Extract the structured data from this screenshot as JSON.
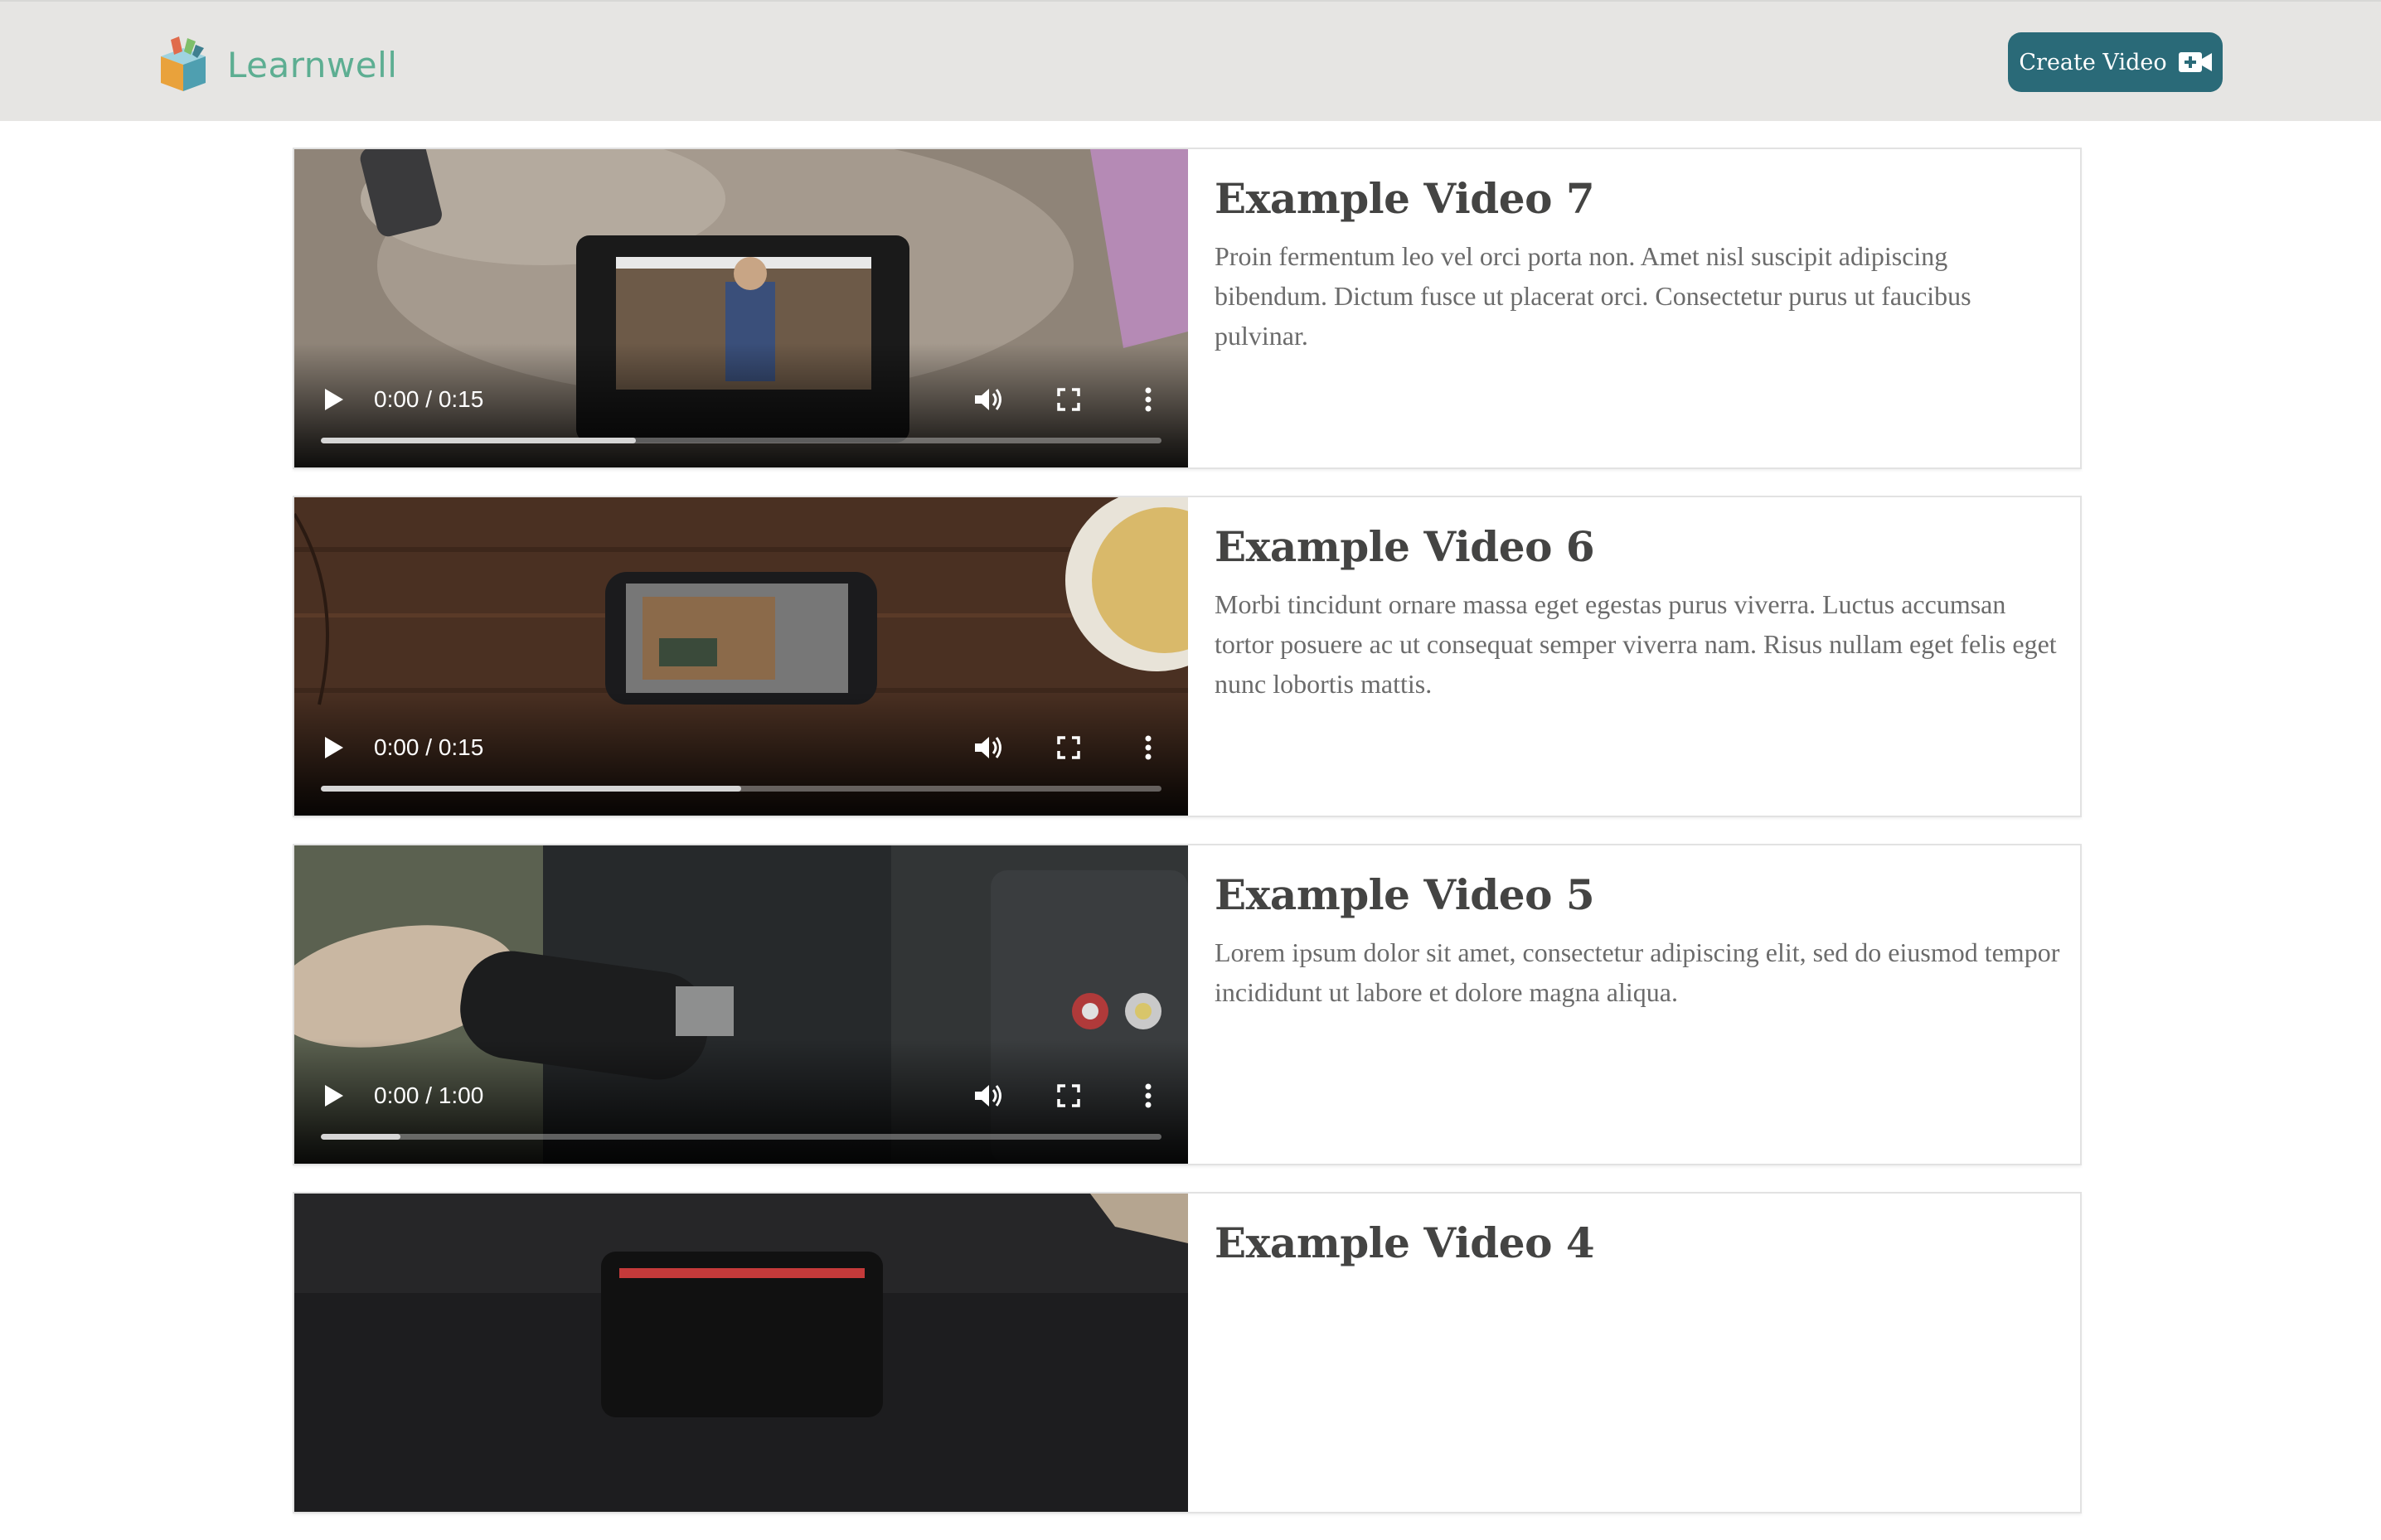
{
  "header": {
    "brand": "Learnwell",
    "create_button_label": "Create Video"
  },
  "colors": {
    "header_bg": "#e6e5e3",
    "brand_green": "#5dae92",
    "button_bg": "#2a6a78",
    "title_text": "#444443",
    "body_text": "#6b6b6b"
  },
  "videos": [
    {
      "title": "Example Video 7",
      "description": "Proin fermentum leo vel orci porta non. Amet nisl suscipit adipiscing bibendum. Dictum fusce ut placerat orci. Consectetur purus ut faucibus pulvinar.",
      "time": "0:00 / 0:15",
      "progress": 0.375
    },
    {
      "title": "Example Video 6",
      "description": "Morbi tincidunt ornare massa eget egestas purus viverra. Luctus accumsan tortor posuere ac ut consequat semper viverra nam. Risus nullam eget felis eget nunc lobortis mattis.",
      "time": "0:00 / 0:15",
      "progress": 0.5
    },
    {
      "title": "Example Video 5",
      "description": "Lorem ipsum dolor sit amet, consectetur adipiscing elit, sed do eiusmod tempor incididunt ut labore et dolore magna aliqua.",
      "time": "0:00 / 1:00",
      "progress": 0.095
    },
    {
      "title": "Example Video 4",
      "description": "",
      "time": "",
      "progress": 0
    }
  ]
}
